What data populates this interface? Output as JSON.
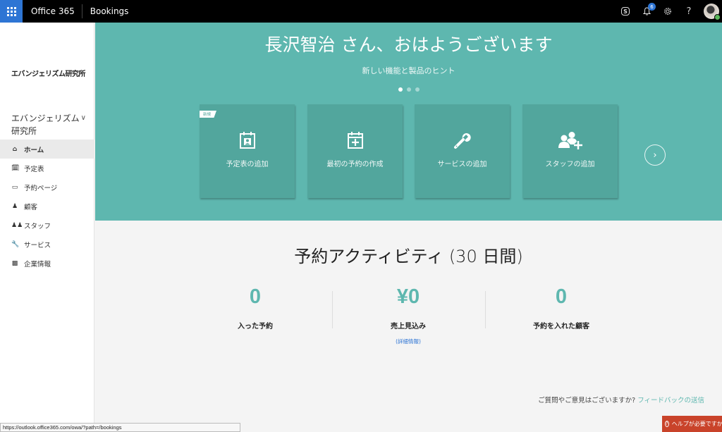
{
  "topbar": {
    "brand": "Office 365",
    "app_name": "Bookings",
    "notification_count": "6",
    "icons": [
      "waffle-icon",
      "skype-icon",
      "bell-icon",
      "gear-icon",
      "help-icon",
      "avatar"
    ],
    "help_glyph": "?"
  },
  "sidebar": {
    "org_logo": "エバンジェリズム研究所",
    "org_select": "エバンジェリズム研究所",
    "items": [
      {
        "label": "ホーム",
        "icon": "home-icon",
        "active": true
      },
      {
        "label": "予定表",
        "icon": "calendar-icon",
        "active": false
      },
      {
        "label": "予約ページ",
        "icon": "laptop-icon",
        "active": false
      },
      {
        "label": "顧客",
        "icon": "customer-icon",
        "active": false
      },
      {
        "label": "スタッフ",
        "icon": "staff-icon",
        "active": false
      },
      {
        "label": "サービス",
        "icon": "wrench-icon",
        "active": false
      },
      {
        "label": "企業情報",
        "icon": "briefcase-icon",
        "active": false
      }
    ]
  },
  "hero": {
    "greeting": "長沢智治 さん、おはようございます",
    "subtitle": "新しい機能と製品のヒント",
    "carousel_pages": 3,
    "carousel_active": 1,
    "cards": [
      {
        "label": "予定表の追加",
        "icon": "calendar-person-icon",
        "tag": "新規"
      },
      {
        "label": "最初の予約の作成",
        "icon": "calendar-plus-icon",
        "tag": ""
      },
      {
        "label": "サービスの追加",
        "icon": "wrench-icon",
        "tag": ""
      },
      {
        "label": "スタッフの追加",
        "icon": "add-people-icon",
        "tag": ""
      }
    ],
    "next_glyph": "›"
  },
  "activity": {
    "title": "予約アクティビティ (30 日間)",
    "stats": [
      {
        "value": "0",
        "label": "入った予約",
        "link": ""
      },
      {
        "value": "¥0",
        "label": "売上見込み",
        "link": "(詳細情報)"
      },
      {
        "value": "0",
        "label": "予約を入れた顧客",
        "link": ""
      }
    ]
  },
  "footer": {
    "feedback_prompt": "ご質問やご意見はございますか? ",
    "feedback_link": "フィードバックの送信",
    "help_button": "ヘルプが必要ですか?",
    "status_url": "https://outlook.office365.com/owa/?path=/bookings"
  },
  "colors": {
    "accent": "#5eb7af",
    "card": "#52a69d",
    "waffle": "#2e75d4",
    "help": "#c9432a"
  }
}
